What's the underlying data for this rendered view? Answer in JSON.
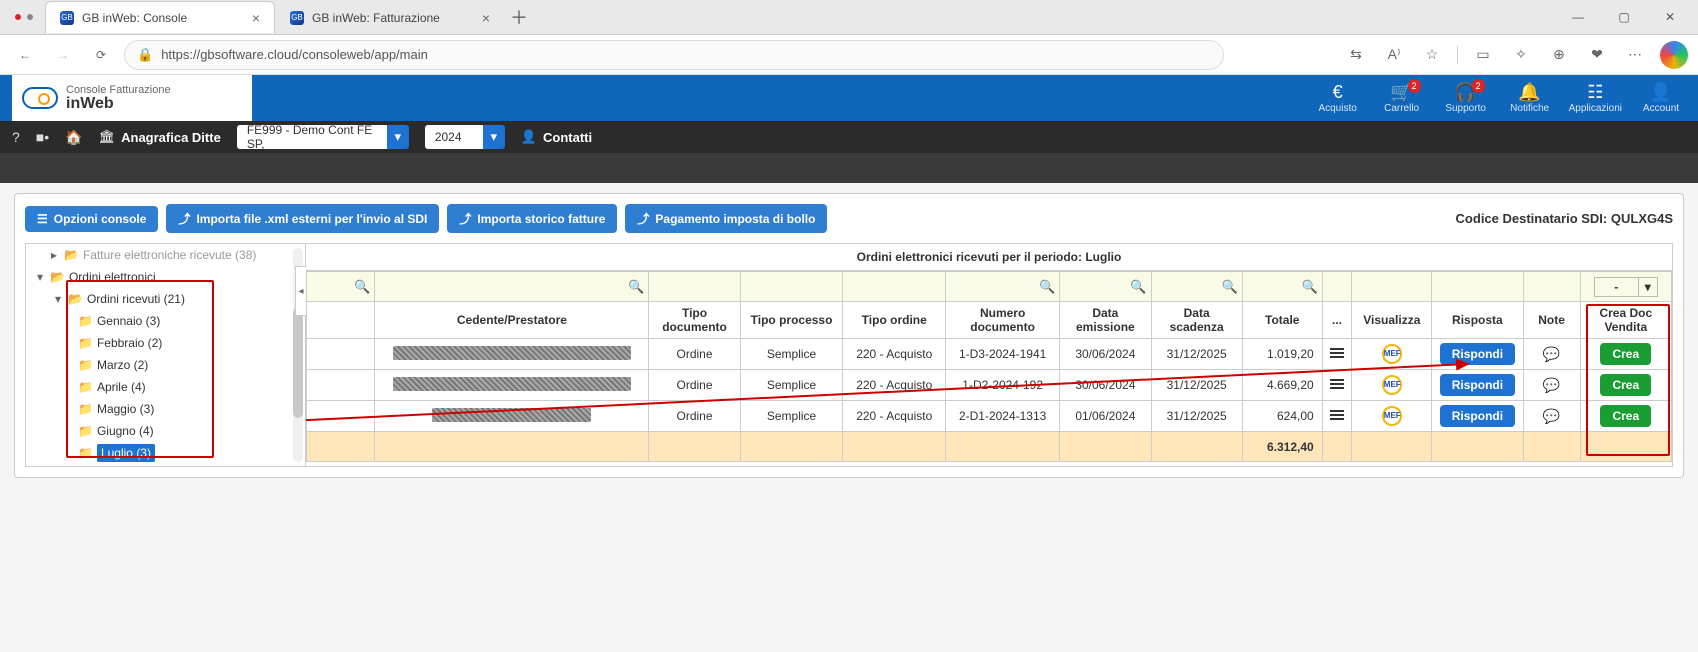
{
  "window": {
    "tabs": [
      {
        "favicon": "GB",
        "title": "GB inWeb: Console",
        "active": true
      },
      {
        "favicon": "GB",
        "title": "GB inWeb: Fatturazione",
        "active": false
      }
    ],
    "url": "https://gbsoftware.cloud/consoleweb/app/main"
  },
  "app_header": {
    "brand_line1": "Console Fatturazione",
    "brand_line2": "inWeb",
    "right_items": [
      {
        "icon": "€",
        "label": "Acquisto",
        "badge": null
      },
      {
        "icon": "🛒",
        "label": "Carrello",
        "badge": "2"
      },
      {
        "icon": "🎧",
        "label": "Supporto",
        "badge": "2"
      },
      {
        "icon": "🔔",
        "label": "Notifiche",
        "badge": null
      },
      {
        "icon": "☷",
        "label": "Applicazioni",
        "badge": null
      },
      {
        "icon": "👤",
        "label": "Account",
        "badge": null
      }
    ]
  },
  "sub_bar": {
    "anagrafica_label": "Anagrafica Ditte",
    "company_select": "FE999 - Demo Cont FE SP,",
    "year_select": "2024",
    "contatti_label": "Contatti"
  },
  "toolbar": {
    "opzioni": "Opzioni console",
    "importa_xml": "Importa file .xml esterni per l'invio al SDI",
    "importa_storico": "Importa storico fatture",
    "pagamento_bollo": "Pagamento imposta di bollo",
    "codice_dest_label": "Codice Destinatario SDI:",
    "codice_dest_value": "QULXG4S"
  },
  "tree": {
    "cut_top": "Fatture elettroniche ricevute (38)",
    "root_label": "Ordini elettronici",
    "received_label": "Ordini ricevuti (21)",
    "months": [
      {
        "label": "Gennaio (3)"
      },
      {
        "label": "Febbraio (2)"
      },
      {
        "label": "Marzo (2)"
      },
      {
        "label": "Aprile (4)"
      },
      {
        "label": "Maggio (3)"
      },
      {
        "label": "Giugno (4)"
      },
      {
        "label": "Luglio (3)",
        "selected": true
      }
    ]
  },
  "grid": {
    "title": "Ordini elettronici ricevuti per il periodo: Luglio",
    "filter_mini_select": "-",
    "columns": [
      "Cedente/Prestatore",
      "Tipo documento",
      "Tipo processo",
      "Tipo ordine",
      "Numero documento",
      "Data emissione",
      "Data scadenza",
      "Totale",
      "...",
      "Visualizza",
      "Risposta",
      "Note",
      "Crea Doc Vendita"
    ],
    "rows": [
      {
        "cedente": "(censored)",
        "tipo_doc": "Ordine",
        "tipo_proc": "Semplice",
        "tipo_ord": "220 - Acquisto",
        "num": "1-D3-2024-1941",
        "emiss": "30/06/2024",
        "scad": "31/12/2025",
        "tot": "1.019,20",
        "risposta": "Rispondi",
        "crea": "Crea"
      },
      {
        "cedente": "(censored)",
        "tipo_doc": "Ordine",
        "tipo_proc": "Semplice",
        "tipo_ord": "220 - Acquisto",
        "num": "1-D2-2024-192",
        "emiss": "30/06/2024",
        "scad": "31/12/2025",
        "tot": "4.669,20",
        "risposta": "Rispondi",
        "crea": "Crea"
      },
      {
        "cedente": "(censored)",
        "tipo_doc": "Ordine",
        "tipo_proc": "Semplice",
        "tipo_ord": "220 - Acquisto",
        "num": "2-D1-2024-1313",
        "emiss": "01/06/2024",
        "scad": "31/12/2025",
        "tot": "624,00",
        "risposta": "Rispondi",
        "crea": "Crea"
      }
    ],
    "footer_total": "6.312,40"
  }
}
